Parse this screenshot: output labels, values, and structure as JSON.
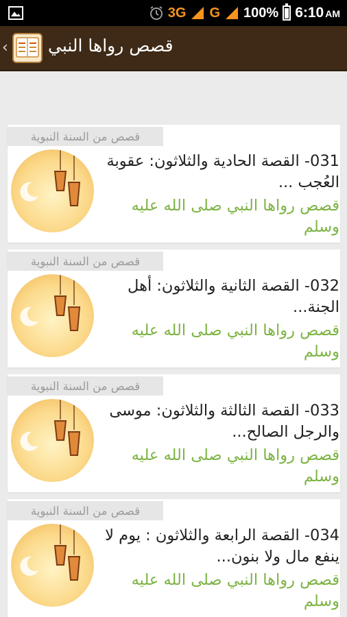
{
  "status_bar": {
    "network_1": "3G",
    "network_2": "G",
    "battery": "100%",
    "time": "6:10",
    "ampm": "AM",
    "icons": [
      "image-icon",
      "alarm-icon",
      "signal-icon",
      "battery-icon"
    ]
  },
  "action_bar": {
    "title": "قصص رواها النبي",
    "back_glyph": "‹",
    "app_icon": "book-app-icon"
  },
  "cards": [
    {
      "category": "قصص من السنة النبوية",
      "headline": "031- القصة الحادية والثلاثون: عقوبة العُجب ...",
      "subline": "قصص رواها النبي صلى الله عليه وسلم"
    },
    {
      "category": "قصص من السنة النبوية",
      "headline": "032- القصة الثانية والثلاثون: أهل الجنة...",
      "subline": "قصص رواها النبي صلى الله عليه وسلم"
    },
    {
      "category": "قصص من السنة النبوية",
      "headline": "033- القصة الثالثة والثلاثون: موسى والرجل الصالح...",
      "subline": "قصص رواها النبي صلى الله عليه وسلم"
    },
    {
      "category": "قصص من السنة النبوية",
      "headline": "034- القصة الرابعة والثلاثون : يوم لا ينفع مال ولا بنون...",
      "subline": "قصص رواها النبي صلى الله عليه وسلم"
    }
  ],
  "colors": {
    "action_bar": "#3e2a16",
    "subline": "#7cb342",
    "background": "#ebebeb",
    "tag_bg": "#e6e6e6"
  }
}
